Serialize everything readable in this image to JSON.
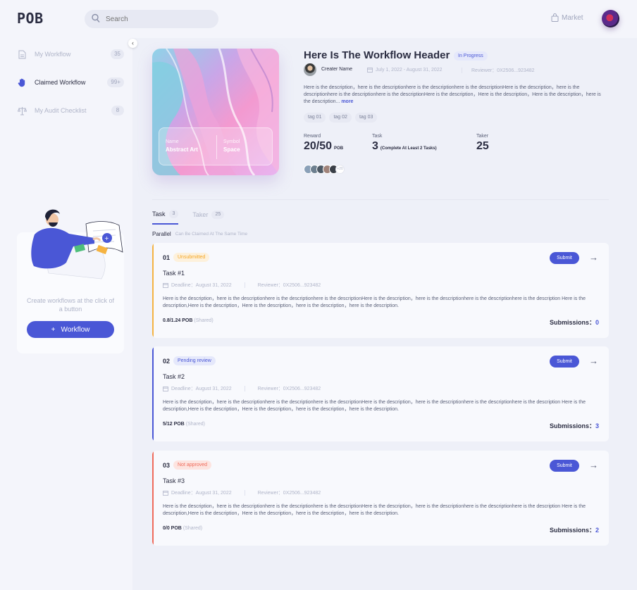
{
  "header": {
    "logo": "POB",
    "search_placeholder": "Search",
    "market_label": "Market"
  },
  "sidebar": {
    "items": [
      {
        "label": "My Workflow",
        "count": "35",
        "icon": "document-icon"
      },
      {
        "label": "Claimed Workflow",
        "count": "99+",
        "icon": "hand-icon",
        "active": true
      },
      {
        "label": "My Audit Checklist",
        "count": "8",
        "icon": "scale-icon"
      }
    ],
    "create_text": "Create workflows at the click of a button",
    "create_button": "Workflow"
  },
  "workflow": {
    "cover": {
      "name_label": "Name",
      "name_value": "Abstract Art",
      "symbol_label": "Symbol",
      "symbol_value": "Space"
    },
    "title": "Here Is The Workflow Header",
    "status": "In Progress",
    "creator": "Creater Name",
    "date_range": "July 1, 2022 - August 31, 2022",
    "reviewer": "Reviewer：0X2506...923482",
    "description": "Here is the description，here is the descriptionhere is the descriptionhere is the descriptionHere is the description，here is the descriptionhere is the descriptionhere is the descriptionHere is the description，Here is the description，Here is the description，here is the description...",
    "more": "more",
    "tags": [
      "tag 01",
      "tag 02",
      "tag 03"
    ],
    "reward_label": "Reward",
    "reward_value": "20/50",
    "reward_unit": "POB",
    "task_label": "Task",
    "task_value": "3",
    "task_note": "(Complete At Least 2 Tasks)",
    "taker_label": "Taker",
    "taker_value": "25",
    "takers_more": "+20"
  },
  "tabs": [
    {
      "label": "Task",
      "count": "3",
      "active": true
    },
    {
      "label": "Taker",
      "count": "25",
      "active": false
    }
  ],
  "parallel": {
    "label": "Parallel",
    "hint": "Can Be Claimed At The Same Time"
  },
  "tasks": [
    {
      "num": "01",
      "status": "Unsubmitted",
      "status_color": "#f5a623",
      "name": "Task #1",
      "deadline": "Deadline：August 31, 2022",
      "reviewer": "Reviewer：0X2506...923482",
      "description": "Here is the description，here is the descriptionhere is the descriptionhere is the descriptionHere is the description，here is the descriptionhere is the descriptionhere is the description Here is the description,Here is the description，Here is the description，here is the description，here is the description.",
      "pob": "0.8/1.24 POB",
      "shared": "(Shared)",
      "submissions_label": "Submissions：",
      "submissions": "0",
      "submit_label": "Submit"
    },
    {
      "num": "02",
      "status": "Pending review",
      "status_color": "#4a57d6",
      "name": "Task #2",
      "deadline": "Deadline：August 31, 2022",
      "reviewer": "Reviewer：0X2506...923482",
      "description": "Here is the description，here is the descriptionhere is the descriptionhere is the descriptionHere is the description，here is the descriptionhere is the descriptionhere is the description Here is the description,Here is the description，Here is the description，here is the description，here is the description.",
      "pob": "5/12 POB",
      "shared": "(Shared)",
      "submissions_label": "Submissions：",
      "submissions": "3",
      "submit_label": "Submit"
    },
    {
      "num": "03",
      "status": "Not approved",
      "status_color": "#ef6b5b",
      "name": "Task #3",
      "deadline": "Deadline：August 31, 2022",
      "reviewer": "Reviewer：0X2506...923482",
      "description": "Here is the description，here is the descriptionhere is the descriptionhere is the descriptionHere is the description，here is the descriptionhere is the descriptionhere is the description Here is the description,Here is the description，Here is the description，here is the description，here is the description.",
      "pob": "0/0 POB",
      "shared": "(Shared)",
      "submissions_label": "Submissions：",
      "submissions": "2",
      "submit_label": "Submit"
    }
  ],
  "colors": {
    "accent": "#4a57d6",
    "unsubmitted": "#f5a623",
    "pending": "#4a57d6",
    "rejected": "#ef6b5b"
  }
}
